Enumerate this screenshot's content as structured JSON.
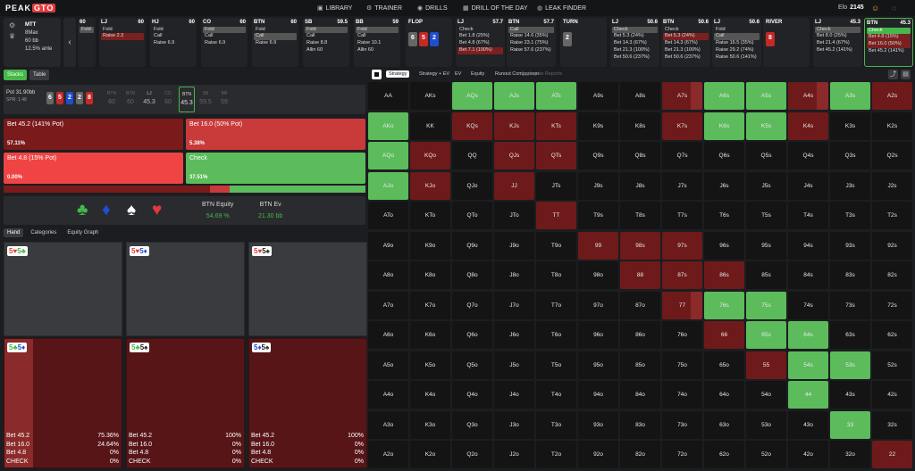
{
  "app": {
    "logo_a": "PEAK",
    "logo_b": "GTO",
    "elo_label": "Elo",
    "elo_value": "2145"
  },
  "nav": [
    {
      "label": "LIBRARY",
      "icon": "library-icon"
    },
    {
      "label": "TRAINER",
      "icon": "trainer-icon"
    },
    {
      "label": "DRILLS",
      "icon": "drills-icon"
    },
    {
      "label": "DRILL OF THE DAY",
      "icon": "calendar-icon"
    },
    {
      "label": "LEAK FINDER",
      "icon": "leak-finder-icon"
    }
  ],
  "game": {
    "type": "MTT",
    "format": "8Max",
    "stack": "60 bb",
    "ante": "12.5% ante"
  },
  "streets": [
    {
      "pos": "",
      "stack": "60",
      "actions": [
        {
          "t": "Fold",
          "s": "sel"
        }
      ]
    },
    {
      "pos": "LJ",
      "stack": "60",
      "actions": [
        {
          "t": "Fold",
          "s": ""
        },
        {
          "t": "Raise 2.3",
          "s": "red"
        }
      ]
    },
    {
      "pos": "HJ",
      "stack": "60",
      "actions": [
        {
          "t": "Fold",
          "s": ""
        },
        {
          "t": "Call",
          "s": ""
        },
        {
          "t": "Raise 6.9",
          "s": ""
        }
      ]
    },
    {
      "pos": "CO",
      "stack": "60",
      "actions": [
        {
          "t": "Fold",
          "s": "sel"
        },
        {
          "t": "Call",
          "s": ""
        },
        {
          "t": "Raise 6.9",
          "s": ""
        }
      ]
    },
    {
      "pos": "BTN",
      "stack": "60",
      "actions": [
        {
          "t": "Fold",
          "s": ""
        },
        {
          "t": "Call",
          "s": "sel"
        },
        {
          "t": "Raise 6.9",
          "s": ""
        }
      ]
    },
    {
      "pos": "SB",
      "stack": "59.5",
      "actions": [
        {
          "t": "Fold",
          "s": "sel"
        },
        {
          "t": "Call",
          "s": ""
        },
        {
          "t": "Raise 8.8",
          "s": ""
        },
        {
          "t": "Allin 60",
          "s": ""
        }
      ]
    },
    {
      "pos": "BB",
      "stack": "59",
      "actions": [
        {
          "t": "Fold",
          "s": "sel"
        },
        {
          "t": "Call",
          "s": ""
        },
        {
          "t": "Raise 10.1",
          "s": ""
        },
        {
          "t": "Allin 60",
          "s": ""
        }
      ]
    }
  ],
  "flop": {
    "label": "FLOP",
    "cards": [
      {
        "r": "6",
        "c": "#666"
      },
      {
        "r": "5",
        "c": "#c62828"
      },
      {
        "r": "2",
        "c": "#1e4fcf"
      }
    ]
  },
  "flop_actions": [
    {
      "pos": "LJ",
      "stack": "57.7",
      "actions": [
        {
          "t": "Check",
          "s": ""
        },
        {
          "t": "Bet 1.8 (25%)",
          "s": ""
        },
        {
          "t": "Bet 4.8 (67%)",
          "s": ""
        },
        {
          "t": "Bet 7.1 (100%)",
          "s": "red"
        }
      ]
    },
    {
      "pos": "BTN",
      "stack": "57.7",
      "actions": [
        {
          "t": "Call",
          "s": "sel"
        },
        {
          "t": "Raise 14.6 (35%)",
          "s": ""
        },
        {
          "t": "Raise 23.1 (75%)",
          "s": ""
        },
        {
          "t": "Raise 57.6 (237%)",
          "s": ""
        }
      ]
    }
  ],
  "turn": {
    "label": "TURN",
    "cards": [
      {
        "r": "2",
        "c": "#666"
      }
    ]
  },
  "turn_actions": [
    {
      "pos": "LJ",
      "stack": "50.6",
      "actions": [
        {
          "t": "Check",
          "s": "sel"
        },
        {
          "t": "Bet 5.3 (24%)",
          "s": ""
        },
        {
          "t": "Bet 14.3 (67%)",
          "s": ""
        },
        {
          "t": "Bet 21.3 (100%)",
          "s": ""
        },
        {
          "t": "Bet 50.6 (237%)",
          "s": ""
        }
      ]
    },
    {
      "pos": "BTN",
      "stack": "50.6",
      "actions": [
        {
          "t": "Check",
          "s": ""
        },
        {
          "t": "Bet 5.3 (24%)",
          "s": "red"
        },
        {
          "t": "Bet 14.3 (67%)",
          "s": ""
        },
        {
          "t": "Bet 21.3 (100%)",
          "s": ""
        },
        {
          "t": "Bet 50.6 (237%)",
          "s": ""
        }
      ]
    },
    {
      "pos": "LJ",
      "stack": "50.6",
      "actions": [
        {
          "t": "Fold",
          "s": ""
        },
        {
          "t": "Call",
          "s": "sel"
        },
        {
          "t": "Raise 16.5 (35%)",
          "s": ""
        },
        {
          "t": "Raise 29.2 (74%)",
          "s": ""
        },
        {
          "t": "Raise 50.6 (141%)",
          "s": ""
        }
      ]
    }
  ],
  "river": {
    "label": "RIVER",
    "cards": [
      {
        "r": "8",
        "c": "#c62828"
      }
    ]
  },
  "river_actions": [
    {
      "pos": "LJ",
      "stack": "45.3",
      "actions": [
        {
          "t": "Check",
          "s": "sel"
        },
        {
          "t": "Bet 8.0 (25%)",
          "s": ""
        },
        {
          "t": "Bet 21.4 (67%)",
          "s": ""
        },
        {
          "t": "Bet 45.2 (141%)",
          "s": ""
        }
      ]
    },
    {
      "pos": "BTN",
      "stack": "45.3",
      "actions": [
        {
          "t": "Check",
          "s": "gsel"
        },
        {
          "t": "Bet 4.8 (15%)",
          "s": "red"
        },
        {
          "t": "Bet 16.0 (50%)",
          "s": "red"
        },
        {
          "t": "Bet 45.2 (141%)",
          "s": ""
        }
      ]
    }
  ],
  "left_tabs": [
    "Stacks",
    "Table"
  ],
  "pot": {
    "label": "Pot",
    "value": "31.90bb",
    "spr": "SPR: 1.48"
  },
  "board": [
    {
      "r": "6",
      "c": "#666"
    },
    {
      "r": "5",
      "c": "#c62828"
    },
    {
      "r": "2",
      "c": "#1e4fcf"
    },
    {
      "r": "2",
      "c": "#666"
    },
    {
      "r": "8",
      "c": "#c62828"
    }
  ],
  "positions": [
    {
      "n": "BTN",
      "v": "60",
      "st": ""
    },
    {
      "n": "BTN",
      "v": "60",
      "st": ""
    },
    {
      "n": "LJ",
      "v": "45.3",
      "st": "lit"
    },
    {
      "n": "CO",
      "v": "60",
      "st": ""
    },
    {
      "n": "BTN",
      "v": "45.3",
      "st": "act"
    },
    {
      "n": "SB",
      "v": "59.5",
      "st": ""
    },
    {
      "n": "BB",
      "v": "59",
      "st": ""
    }
  ],
  "strategy_actions": [
    {
      "label": "Bet 45.2 (141% Pot)",
      "freq": "57.11%",
      "bg": "#7a1a1a"
    },
    {
      "label": "Bet 16.0 (50% Pot)",
      "freq": "5.38%",
      "bg": "#c93a3a"
    },
    {
      "label": "Bet 4.8 (15% Pot)",
      "freq": "0.00%",
      "bg": "#f04444"
    },
    {
      "label": "Check",
      "freq": "37.51%",
      "bg": "#5cbc5c"
    }
  ],
  "freq_bar": [
    {
      "w": 57.11,
      "c": "#7a1a1a"
    },
    {
      "w": 5.38,
      "c": "#c93a3a"
    },
    {
      "w": 37.51,
      "c": "#5cbc5c"
    }
  ],
  "suits": [
    {
      "s": "♣",
      "c": "#44b84a"
    },
    {
      "s": "♦",
      "c": "#1e4fcf"
    },
    {
      "s": "♠",
      "c": "#ffffff"
    },
    {
      "s": "♥",
      "c": "#e23a3a"
    }
  ],
  "equity": {
    "eq_label": "BTN Equity",
    "eq_value": "54.69 %",
    "ev_label": "BTN Ev",
    "ev_value": "21.30 bb"
  },
  "hand_tabs": [
    "Hand",
    "Categories",
    "Equity Graph"
  ],
  "hand_cells": [
    {
      "cards": [
        {
          "r": "5",
          "s": "♥",
          "c": "#e23a3a"
        },
        {
          "r": "5",
          "s": "♣",
          "c": "#44b84a"
        }
      ],
      "type": "dark",
      "rows": []
    },
    {
      "cards": [
        {
          "r": "5",
          "s": "♥",
          "c": "#e23a3a"
        },
        {
          "r": "5",
          "s": "♦",
          "c": "#1e4fcf"
        }
      ],
      "type": "dark",
      "rows": []
    },
    {
      "cards": [
        {
          "r": "5",
          "s": "♥",
          "c": "#e23a3a"
        },
        {
          "r": "5",
          "s": "♠",
          "c": "#222"
        }
      ],
      "type": "dark",
      "rows": []
    },
    {
      "cards": [
        {
          "r": "5",
          "s": "♣",
          "c": "#44b84a"
        },
        {
          "r": "5",
          "s": "♦",
          "c": "#1e4fcf"
        }
      ],
      "type": "red",
      "fill": 0.2436,
      "rows": [
        [
          "Bet 45.2",
          "75.36%"
        ],
        [
          "Bet 16.0",
          "24.64%"
        ],
        [
          "Bet 4.8",
          "0%"
        ],
        [
          "CHECK",
          "0%"
        ]
      ]
    },
    {
      "cards": [
        {
          "r": "5",
          "s": "♣",
          "c": "#44b84a"
        },
        {
          "r": "5",
          "s": "♠",
          "c": "#222"
        }
      ],
      "type": "red",
      "fill": 0,
      "rows": [
        [
          "Bet 45.2",
          "100%"
        ],
        [
          "Bet 16.0",
          "0%"
        ],
        [
          "Bet 4.8",
          "0%"
        ],
        [
          "CHECK",
          "0%"
        ]
      ]
    },
    {
      "cards": [
        {
          "r": "5",
          "s": "♦",
          "c": "#1e4fcf"
        },
        {
          "r": "5",
          "s": "♠",
          "c": "#222"
        }
      ],
      "type": "red",
      "fill": 0,
      "rows": [
        [
          "Bet 45.2",
          "100%"
        ],
        [
          "Bet 16.0",
          "0%"
        ],
        [
          "Bet 4.8",
          "0%"
        ],
        [
          "CHECK",
          "0%"
        ]
      ]
    }
  ],
  "right_tabs": [
    "Strategy",
    "Strategy + EV",
    "EV",
    "Equity",
    "Runout Comparison",
    "Aggregate Reports"
  ],
  "ranks": [
    "A",
    "K",
    "Q",
    "J",
    "T",
    "9",
    "8",
    "7",
    "6",
    "5",
    "4",
    "3",
    "2"
  ],
  "grid_colors": {
    "green": "#5cbc5c",
    "dred": "#6e1a1a",
    "mred": "#8b2a2a",
    "bred": "#c03535",
    "empty": "#141414"
  },
  "grid_special": {
    "AQs": "g",
    "AJs": "g",
    "ATs": "g",
    "A7s": "m",
    "A6s": "g",
    "A5s": "g",
    "A4s": "m",
    "A3s": "g",
    "A2s": "d",
    "AKo": "g",
    "KQs": "d",
    "KJs": "d",
    "KTs": "d",
    "K7s": "d",
    "K6s": "g",
    "K5s": "g",
    "K4s": "d",
    "AQo": "g",
    "KQo": "d",
    "QJs": "d",
    "QTs": "d",
    "AJo": "g",
    "KJo": "d",
    "JJ": "d",
    "TT": "d",
    "99": "d",
    "98s": "d",
    "97s": "d",
    "88": "d",
    "87s": "d",
    "86s": "d",
    "77": "m",
    "76s": "g",
    "75s": "g",
    "66": "d",
    "65s": "g",
    "64s": "g",
    "55": "d",
    "54s": "g",
    "53s": "g",
    "44": "g",
    "33": "g",
    "22": "d"
  }
}
